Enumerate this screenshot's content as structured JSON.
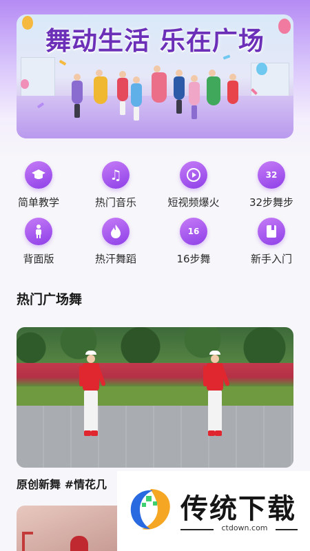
{
  "banner": {
    "title": "舞动生活 乐在广场"
  },
  "categories": [
    {
      "label": "简单教学",
      "icon": "graduation-cap-icon",
      "glyph": ""
    },
    {
      "label": "热门音乐",
      "icon": "music-note-icon",
      "glyph": "♫"
    },
    {
      "label": "短视频爆火",
      "icon": "play-icon",
      "glyph": "▶"
    },
    {
      "label": "32步舞步",
      "icon": "number-32-icon",
      "glyph": "32"
    },
    {
      "label": "背面版",
      "icon": "person-icon",
      "glyph": ""
    },
    {
      "label": "热汗舞蹈",
      "icon": "flame-icon",
      "glyph": ""
    },
    {
      "label": "16步舞",
      "icon": "number-16-icon",
      "glyph": "16"
    },
    {
      "label": "新手入门",
      "icon": "book-icon",
      "glyph": ""
    }
  ],
  "section": {
    "title": "热门广场舞"
  },
  "videos": [
    {
      "caption": "原创新舞 #情花几"
    }
  ],
  "watermark": {
    "brand": "传统下载",
    "url": "ctdown.com"
  },
  "colors": {
    "accent": "#8f3fe8",
    "accent_light": "#c57cf6",
    "banner_title": "#6b2fb8"
  }
}
